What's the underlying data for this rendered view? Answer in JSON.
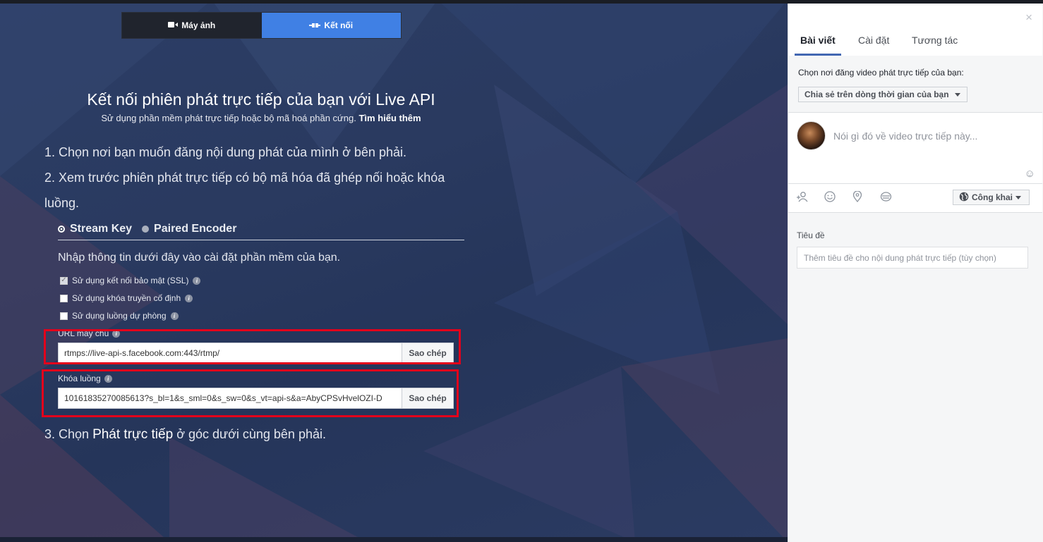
{
  "mode_toggle": {
    "camera_label": "Máy ảnh",
    "connect_label": "Kết nối"
  },
  "main": {
    "title": "Kết nối phiên phát trực tiếp của bạn với Live API",
    "subtitle": "Sử dụng phần mềm phát trực tiếp hoặc bộ mã hoá phần cứng.",
    "learn_more": "Tìm hiểu thêm",
    "step1": "1. Chọn nơi bạn muốn đăng nội dung phát của mình ở bên phải.",
    "step2_line1": "2. Xem trước phiên phát trực tiếp có bộ mã hóa đã ghép nối hoặc khóa",
    "step2_line2": "luồng.",
    "tabs": {
      "stream_key": "Stream Key",
      "paired_encoder": "Paired Encoder",
      "selected": "stream_key"
    },
    "instruction": "Nhập thông tin dưới đây vào cài đặt phần mềm của bạn.",
    "checkboxes": {
      "ssl": {
        "label": "Sử dụng kết nối bảo mật (SSL)",
        "checked": true
      },
      "persistent_key": {
        "label": "Sử dụng khóa truyền cố định",
        "checked": false
      },
      "backup_stream": {
        "label": "Sử dụng luồng dự phòng",
        "checked": false
      }
    },
    "server_url": {
      "label": "URL máy chủ",
      "value": "rtmps://live-api-s.facebook.com:443/rtmp/",
      "copy_label": "Sao chép"
    },
    "stream_key": {
      "label": "Khóa luồng",
      "value": "10161835270085613?s_bl=1&s_sml=0&s_sw=0&s_vt=api-s&a=AbyCPSvHvelOZI-D",
      "copy_label": "Sao chép"
    },
    "step3_prefix": "3. Chọn",
    "step3_bold": "Phát trực tiếp",
    "step3_suffix": "ở góc dưới cùng bên phải."
  },
  "sidebar": {
    "close": "×",
    "tabs": [
      "Bài viết",
      "Cài đặt",
      "Tương tác"
    ],
    "post_target_label": "Chọn nơi đăng video phát trực tiếp của bạn:",
    "post_target_value": "Chia sẻ trên dòng thời gian của bạn",
    "composer_placeholder": "Nói gì đó về video trực tiếp này...",
    "privacy": "Công khai",
    "title_label": "Tiêu đề",
    "title_placeholder": "Thêm tiêu đề cho nội dung phát trực tiếp (tùy chọn)"
  },
  "colors": {
    "accent": "#4080e4",
    "highlight_box": "#e3001b",
    "background": "#2a3a60"
  }
}
